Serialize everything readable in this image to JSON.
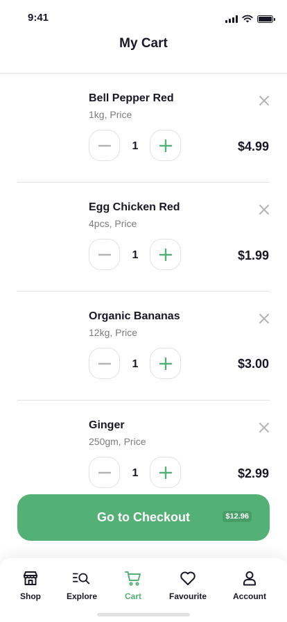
{
  "status_bar": {
    "time": "9:41"
  },
  "header": {
    "title": "My Cart"
  },
  "items": [
    {
      "name": "Bell Pepper Red",
      "desc": "1kg, Price",
      "qty": "1",
      "price": "$4.99"
    },
    {
      "name": "Egg Chicken Red",
      "desc": "4pcs, Price",
      "qty": "1",
      "price": "$1.99"
    },
    {
      "name": "Organic Bananas",
      "desc": "12kg, Price",
      "qty": "1",
      "price": "$3.00"
    },
    {
      "name": "Ginger",
      "desc": "250gm, Price",
      "qty": "1",
      "price": "$2.99"
    }
  ],
  "checkout": {
    "label": "Go to Checkout",
    "total": "$12.96"
  },
  "tabs": [
    {
      "label": "Shop",
      "icon": "store-icon"
    },
    {
      "label": "Explore",
      "icon": "explore-icon"
    },
    {
      "label": "Cart",
      "icon": "cart-icon"
    },
    {
      "label": "Favourite",
      "icon": "heart-icon"
    },
    {
      "label": "Account",
      "icon": "account-icon"
    }
  ],
  "colors": {
    "accent": "#53B175",
    "text": "#181725",
    "muted": "#7C7C7C",
    "border": "#E2E2E2"
  }
}
